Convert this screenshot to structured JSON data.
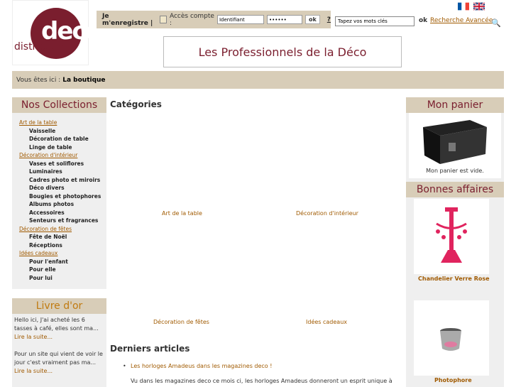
{
  "logo": {
    "brand_top": "deco",
    "brand_bottom": "distributio"
  },
  "account": {
    "register": "Je m'enregistre |",
    "access": "Accès compte :",
    "username_value": "Identifiant",
    "password_value": "••••••",
    "ok": "ok",
    "help": "?"
  },
  "search": {
    "placeholder": "Tapez vos mots clés",
    "ok": "ok",
    "advanced": "Recherche Avancée"
  },
  "banner": {
    "text": "Les Professionnels de la Déco"
  },
  "breadcrumb": {
    "prefix": "Vous êtes ici :",
    "link": "La boutique"
  },
  "left": {
    "title": "Nos Collections",
    "items": [
      {
        "label": "Art de la table",
        "type": "cat"
      },
      {
        "label": "Vaisselle",
        "type": "sub"
      },
      {
        "label": "Décoration de table",
        "type": "sub"
      },
      {
        "label": "Linge de table",
        "type": "sub"
      },
      {
        "label": "Décoration d'intérieur",
        "type": "cat"
      },
      {
        "label": "Vases et soliflores",
        "type": "sub"
      },
      {
        "label": "Luminaires",
        "type": "sub"
      },
      {
        "label": "Cadres photo et miroirs",
        "type": "sub"
      },
      {
        "label": "Déco divers",
        "type": "sub"
      },
      {
        "label": "Bougies et photophores",
        "type": "sub"
      },
      {
        "label": "Albums photos",
        "type": "sub"
      },
      {
        "label": "Accessoires",
        "type": "sub"
      },
      {
        "label": "Senteurs et fragrances",
        "type": "sub"
      },
      {
        "label": "Décoration de fêtes",
        "type": "cat"
      },
      {
        "label": "Fête de Noël",
        "type": "sub"
      },
      {
        "label": "Réceptions",
        "type": "sub"
      },
      {
        "label": "Idées cadeaux",
        "type": "cat"
      },
      {
        "label": "Pour l'enfant",
        "type": "sub"
      },
      {
        "label": "Pour elle",
        "type": "sub"
      },
      {
        "label": "Pour lui",
        "type": "sub"
      }
    ]
  },
  "livre": {
    "title": "Livre d'or",
    "entries": [
      {
        "text": "Hello ici, J'ai acheté les 6 tasses à café, elles sont ma...",
        "more": "Lire la suite..."
      },
      {
        "text": "Pour un site qui vient de voir le jour c'est vraiment pas ma...",
        "more": "Lire la suite..."
      }
    ]
  },
  "main": {
    "categories_title": "Catégories",
    "categories": [
      "Art de la table",
      "Décoration d'intérieur",
      "Décoration de fêtes",
      "Idées cadeaux"
    ],
    "articles_title": "Derniers articles",
    "article_link": "Les horloges Amadeus dans les magazines deco !",
    "article_text": "Vu dans les magazines deco ce mois ci, les horloges Amadeus donneront un esprit unique à"
  },
  "cart": {
    "title": "Mon panier",
    "empty": "Mon panier est vide."
  },
  "deals": {
    "title": "Bonnes affaires",
    "items": [
      "Chandelier Verre Rose",
      "Photophore"
    ]
  }
}
